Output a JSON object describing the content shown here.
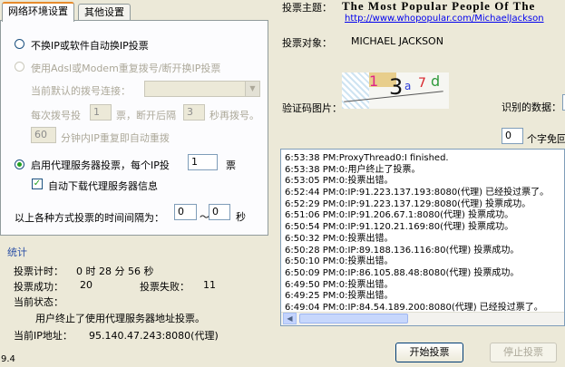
{
  "tabs": {
    "network": "网络环境设置",
    "other": "其他设置"
  },
  "network": {
    "option1_label": "不换IP或软件自动换IP投票",
    "option2_label": "使用Adsl或Modem重复拨号/断开换IP投票",
    "dial_connection_label": "当前默认的拨号连接：",
    "dial_connection_value": "",
    "every_dial_prefix": "每次拨号投",
    "every_dial_votes": "1",
    "votes_disconnect_label": "票，断开后隔",
    "disconnect_seconds": "3",
    "seconds_redial_label": "秒再拨号。",
    "repeat_minutes": "60",
    "repeat_label": "分钟内IP重复即自动重拨",
    "option3_label": "启用代理服务器投票，每个IP投",
    "proxy_votes": "1",
    "proxy_votes_unit": "票",
    "auto_download_label": "自动下载代理服务器信息",
    "interval_label": "以上各种方式投票的时间间隔为：",
    "interval_from": "0",
    "interval_sep": "～",
    "interval_to": "0",
    "interval_unit": "秒"
  },
  "stats": {
    "title": "统计",
    "timer_label": "投票计时：",
    "timer_value": "0 时 28 分 56 秒",
    "success_label": "投票成功：",
    "success_value": "20",
    "fail_label": "投票失败：",
    "fail_value": "11",
    "status_label": "当前状态：",
    "status_value": "用户终止了使用代理服务器地址投票。",
    "ip_label": "当前IP地址：",
    "ip_value": "95.140.47.243:8080(代理)"
  },
  "vote": {
    "theme_label": "投票主题：",
    "theme_value": "The Most Popular People Of The",
    "theme_url": "http://www.whopopular.com/MichaelJackson",
    "target_label": "投票对象：",
    "target_value": "MICHAEL JACKSON",
    "captcha_label": "验证码图片：",
    "captcha_chars": [
      "1",
      "3",
      "a",
      "7",
      "d"
    ],
    "recognized_label": "识别的数据：",
    "free_count": "0",
    "free_label": "个字免回"
  },
  "log": [
    "6:53:38 PM:ProxyThread0:I finished.",
    "6:53:38 PM:0:用户终止了投票。",
    "6:53:05 PM:0:投票出错。",
    "6:52:44 PM:0:IP:91.223.137.193:8080(代理) 已经投过票了。",
    "6:52:29 PM:0:IP:91.223.137.129:8080(代理) 投票成功。",
    "6:51:06 PM:0:IP:91.206.67.1:8080(代理) 投票成功。",
    "6:50:54 PM:0:IP:91.120.21.169:80(代理) 投票成功。",
    "6:50:32 PM:0:投票出错。",
    "6:50:28 PM:0:IP:89.188.136.116:80(代理) 投票成功。",
    "6:50:10 PM:0:投票出错。",
    "6:50:09 PM:0:IP:86.105.88.48:8080(代理) 投票成功。",
    "6:49:50 PM:0:投票出错。",
    "6:49:25 PM:0:投票出错。",
    "6:49:04 PM:0:IP:84.54.189.200:8080(代理) 已经投过票了。"
  ],
  "buttons": {
    "start": "开始投票",
    "stop": "停止投票"
  },
  "version": "9.4",
  "colors": {
    "window_bg": "#ece9d8",
    "tab_highlight": "#e68b2c",
    "radio_dot": "#21a121",
    "link": "#0000ee"
  }
}
